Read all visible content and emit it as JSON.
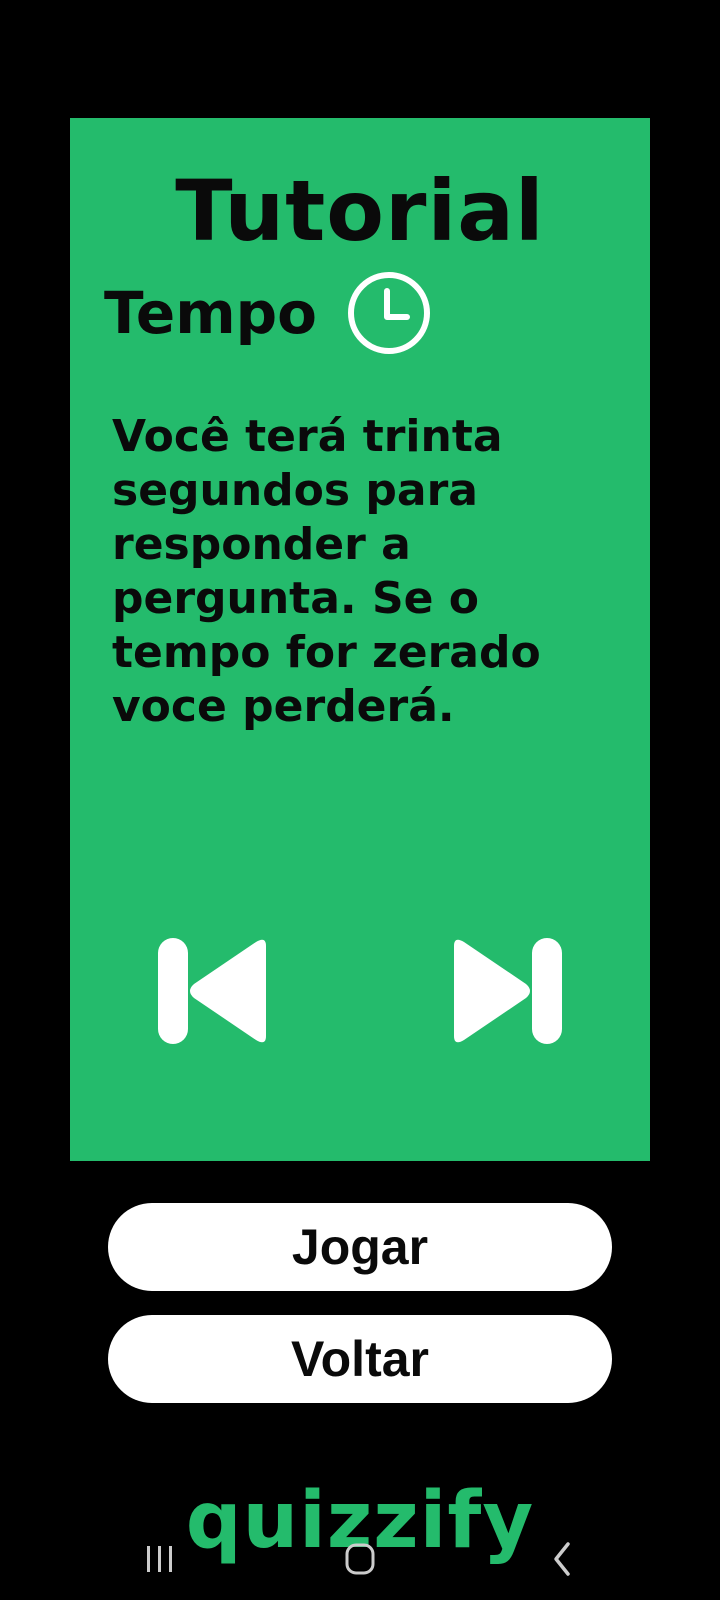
{
  "tutorial": {
    "title": "Tutorial",
    "section_title": "Tempo",
    "section_icon": "clock-icon",
    "body": "Você terá trinta segundos para responder a pergunta. Se o tempo for zerado voce perderá.",
    "prev_icon": "skip-previous-icon",
    "next_icon": "skip-next-icon"
  },
  "actions": {
    "play_label": "Jogar",
    "back_label": "Voltar"
  },
  "brand": {
    "name": "quizzify"
  },
  "system_nav": {
    "recent_icon": "recent-apps-icon",
    "home_icon": "home-icon",
    "back_icon": "back-icon"
  },
  "colors": {
    "background": "#000000",
    "card": "#24bb6c",
    "brand": "#24bb6c",
    "button": "#ffffff",
    "text": "#0a0a0a"
  }
}
